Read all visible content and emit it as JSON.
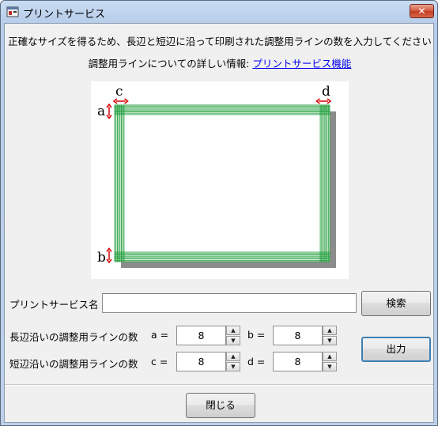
{
  "window": {
    "title": "プリントサービス",
    "close_label": "✕"
  },
  "header": {
    "instruction": "正確なサイズを得るため、長辺と短辺に沿って印刷された調整用ラインの数を入力してください",
    "info_prefix": "調整用ラインについての詳しい情報:",
    "info_link": "プリントサービス機能"
  },
  "diagram": {
    "labels": {
      "a": "a",
      "b": "b",
      "c": "c",
      "d": "d"
    },
    "line_color": "#1f9e3a",
    "marker_color": "#d40000"
  },
  "form": {
    "service_name_label": "プリントサービス名",
    "service_name_value": "",
    "search_button": "検索",
    "long_side_label": "長辺沿いの調整用ラインの数",
    "short_side_label": "短辺沿いの調整用ラインの数",
    "a_label": "a =",
    "a_value": "8",
    "b_label": "b =",
    "b_value": "8",
    "c_label": "c =",
    "c_value": "8",
    "d_label": "d =",
    "d_value": "8",
    "spin_up": "▲",
    "spin_down": "▼",
    "output_button": "出力"
  },
  "footer": {
    "close_button": "閉じる"
  }
}
